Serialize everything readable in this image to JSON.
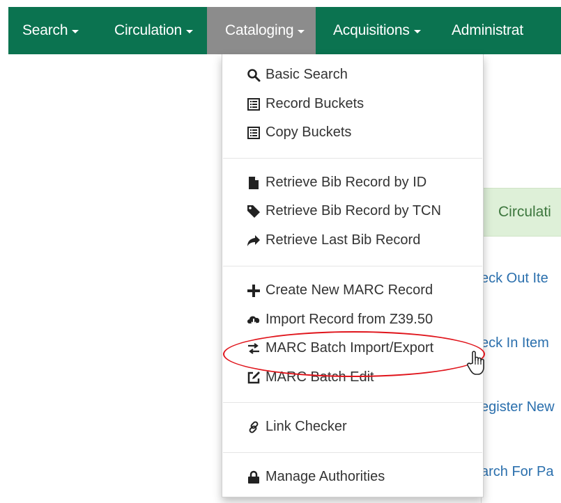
{
  "navbar": {
    "items": [
      {
        "label": "Search"
      },
      {
        "label": "Circulation"
      },
      {
        "label": "Cataloging"
      },
      {
        "label": "Acquisitions"
      },
      {
        "label": "Administrat"
      }
    ],
    "bg_color": "#0b7350",
    "active_color": "#8c8c8c"
  },
  "panel": {
    "header": "Circulati",
    "links": [
      "eck Out Ite",
      "eck In Item",
      "egister New",
      "arch For Pa"
    ]
  },
  "cataloging_menu": {
    "items": [
      {
        "label": "Basic Search",
        "icon": "search-icon"
      },
      {
        "label": "Record Buckets",
        "icon": "list-icon"
      },
      {
        "label": "Copy Buckets",
        "icon": "list-icon"
      },
      {
        "label": "Retrieve Bib Record by ID",
        "icon": "file-icon"
      },
      {
        "label": "Retrieve Bib Record by TCN",
        "icon": "tag-icon"
      },
      {
        "label": "Retrieve Last Bib Record",
        "icon": "share-arrow-icon"
      },
      {
        "label": "Create New MARC Record",
        "icon": "plus-icon"
      },
      {
        "label": "Import Record from Z39.50",
        "icon": "cloud-download-icon"
      },
      {
        "label": "MARC Batch Import/Export",
        "icon": "transfer-icon"
      },
      {
        "label": "MARC Batch Edit",
        "icon": "edit-icon"
      },
      {
        "label": "Link Checker",
        "icon": "link-icon"
      },
      {
        "label": "Manage Authorities",
        "icon": "lock-icon"
      }
    ],
    "highlighted": "MARC Batch Import/Export",
    "highlight_color": "#e0151c"
  }
}
